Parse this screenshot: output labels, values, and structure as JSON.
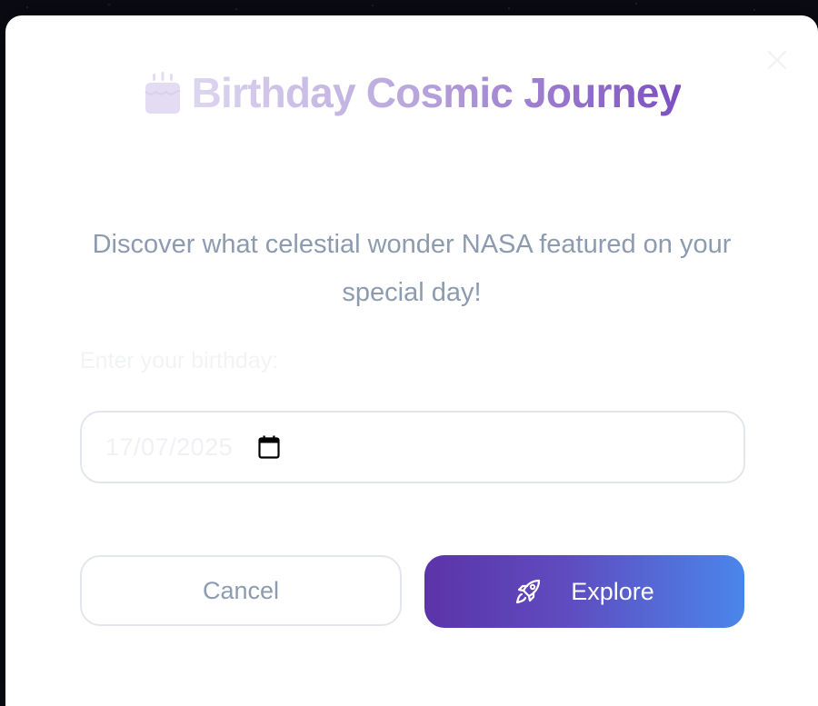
{
  "modal": {
    "title": "Birthday Cosmic Journey",
    "title_icon": "birthday-cake-icon",
    "description": "Discover what celestial wonder NASA featured on your special day!",
    "close_icon": "close-icon"
  },
  "form": {
    "label": "Enter your birthday:",
    "date_value": "17/07/2025",
    "calendar_icon": "calendar-icon"
  },
  "actions": {
    "cancel_label": "Cancel",
    "explore_label": "Explore",
    "explore_icon": "rocket-icon"
  },
  "colors": {
    "accent_start": "#5b34a8",
    "accent_end": "#4a86ea",
    "muted_text": "#8d9bb0",
    "title_purple": "#7c4fc0"
  }
}
